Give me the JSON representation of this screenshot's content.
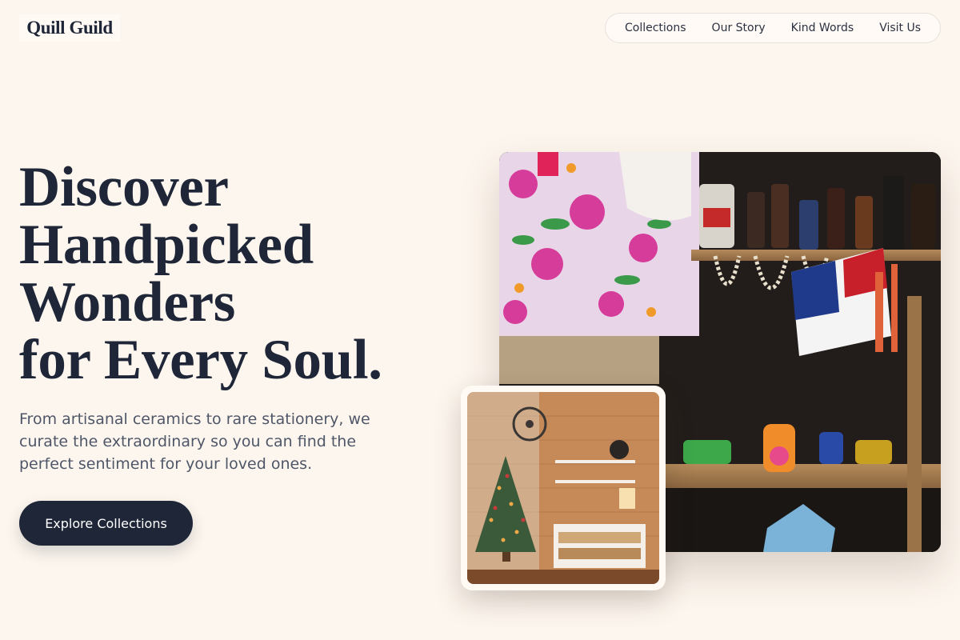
{
  "brand": {
    "name": "Quill Guild"
  },
  "nav": {
    "items": [
      {
        "label": "Collections"
      },
      {
        "label": "Our Story"
      },
      {
        "label": "Kind Words"
      },
      {
        "label": "Visit Us"
      }
    ]
  },
  "hero": {
    "headline_lines": [
      "Discover",
      "Handpicked",
      "Wonders",
      "for Every Soul."
    ],
    "subtext": "From artisanal ceramics to rare stationery, we curate the extraordinary so you can find the perfect sentiment for your loved ones.",
    "cta_label": "Explore Collections"
  },
  "colors": {
    "background": "#fdf6ee",
    "primary": "#1e2638",
    "text_muted": "#4e5668"
  }
}
